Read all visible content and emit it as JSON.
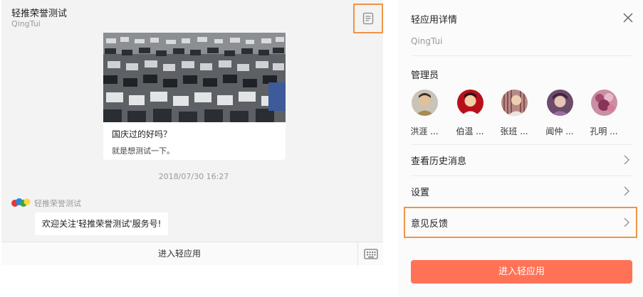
{
  "chat": {
    "title": "轻推荣誉测试",
    "subtitle": "QingTui",
    "detail_icon": "document-icon",
    "card": {
      "title": "国庆过的好吗？",
      "description": "就是想测试一下。"
    },
    "timestamp": "2018/07/30 16:27",
    "sender": "轻推荣誉测试",
    "message": "欢迎关注'轻推荣誉测试'服务号!",
    "footer": {
      "enter_label": "进入轻应用",
      "keyboard_icon": "keyboard-icon"
    }
  },
  "panel": {
    "title": "轻应用详情",
    "close_icon": "close-icon",
    "subtitle": "QingTui",
    "admins_label": "管理员",
    "admins": [
      {
        "name": "洪涯 ..."
      },
      {
        "name": "伯温 ..."
      },
      {
        "name": "张班 ..."
      },
      {
        "name": "闻仲 ..."
      },
      {
        "name": "孔明 ..."
      }
    ],
    "rows": [
      {
        "label": "查看历史消息"
      },
      {
        "label": "设置"
      },
      {
        "label": "意见反馈"
      }
    ],
    "enter_button": "进入轻应用"
  },
  "colors": {
    "highlight": "#f09544",
    "primary_button": "#ff7256",
    "chat_background": "#f3f3f3"
  }
}
